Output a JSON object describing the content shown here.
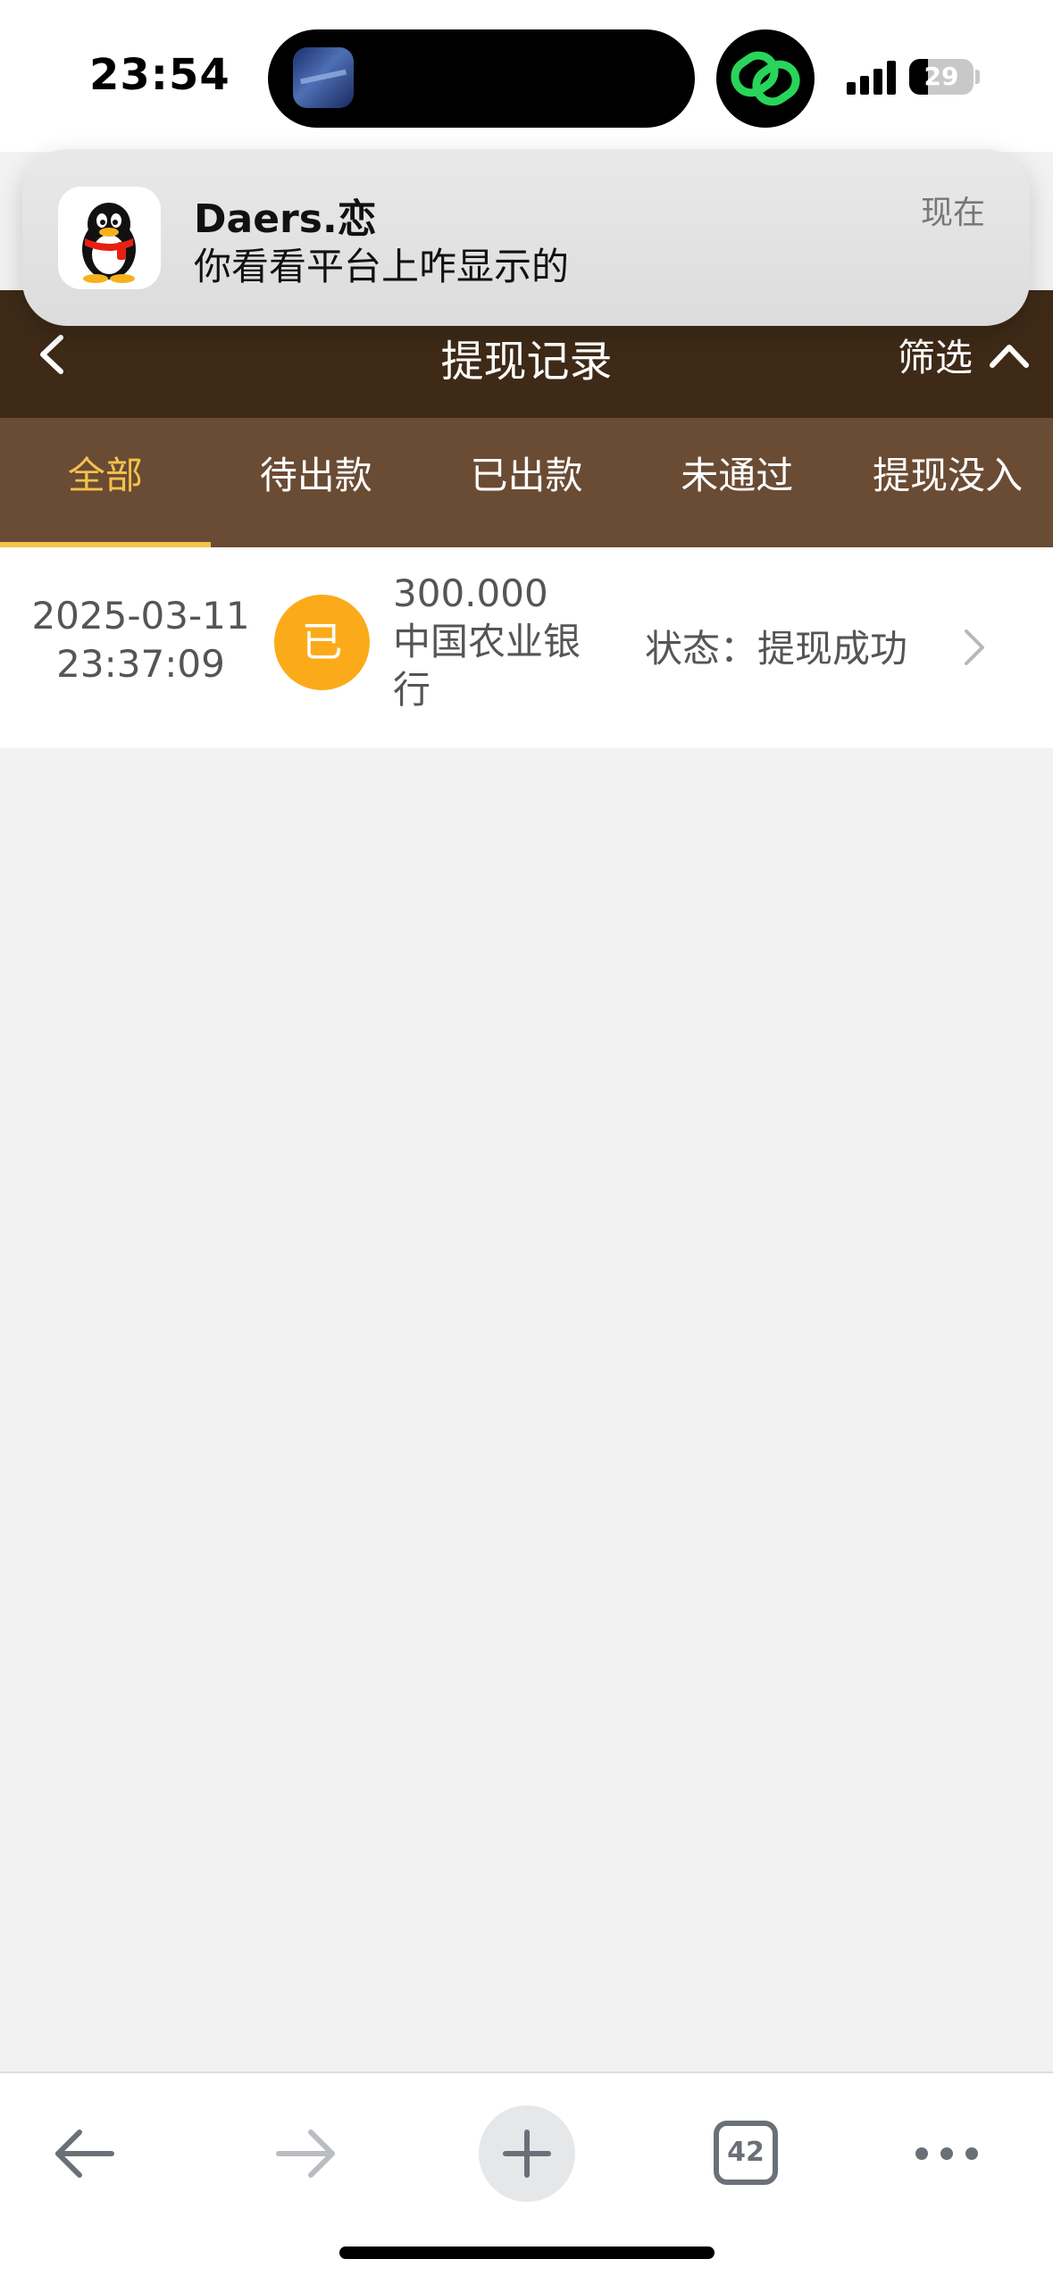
{
  "status_bar": {
    "time": "23:54",
    "battery": "29",
    "battery_level_percent": 29,
    "signal_bars": 4
  },
  "notification": {
    "app_icon": "qq-penguin-icon",
    "title": "Daers.恋",
    "body": "你看看平台上咋显示的",
    "time": "现在"
  },
  "header": {
    "title": "提现记录",
    "filter_label": "筛选",
    "back_icon": "chevron-left-icon",
    "filter_icon": "chevron-up-icon",
    "background_color": "#3e2a17"
  },
  "tabs": [
    {
      "label": "全部",
      "active": true
    },
    {
      "label": "待出款",
      "active": false
    },
    {
      "label": "已出款",
      "active": false
    },
    {
      "label": "未通过",
      "active": false
    },
    {
      "label": "提现没入",
      "active": false
    }
  ],
  "colors": {
    "tab_bar": "#6a4b34",
    "accent": "#f3c24c",
    "badge": "#fbab19"
  },
  "records": [
    {
      "date": "2025-03-11",
      "time": "23:37:09",
      "badge": "已",
      "amount": "300.000",
      "bank": "中国农业银行",
      "status": "状态：提现成功"
    }
  ],
  "toolbar": {
    "back_icon": "arrow-left-icon",
    "forward_icon": "arrow-right-icon",
    "new_tab_icon": "plus-icon",
    "tab_count": "42",
    "more_icon": "more-icon"
  }
}
